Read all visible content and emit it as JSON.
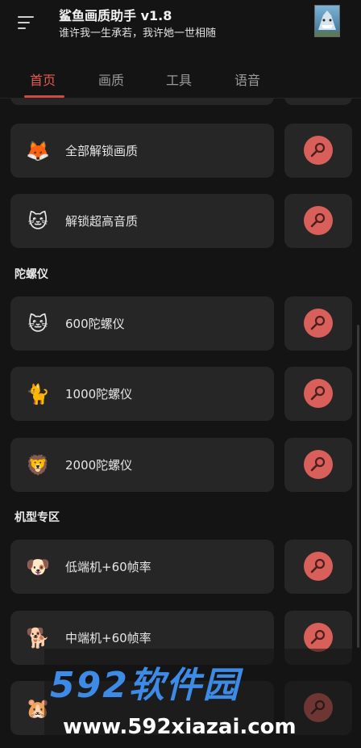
{
  "header": {
    "title": "鲨鱼画质助手 v1.8",
    "subtitle": "谁许我一生承若，我许她一世相随"
  },
  "tabs": [
    {
      "label": "首页",
      "active": true
    },
    {
      "label": "画质",
      "active": false
    },
    {
      "label": "工具",
      "active": false
    },
    {
      "label": "语音",
      "active": false
    }
  ],
  "cards": {
    "unlock_quality": {
      "label": "全部解锁画质",
      "icon": "🦊"
    },
    "unlock_audio": {
      "label": "解锁超高音质",
      "icon": "🐱"
    },
    "gyro_600": {
      "label": "600陀螺仪",
      "icon": "🐱"
    },
    "gyro_1000": {
      "label": "1000陀螺仪",
      "icon": "🐈"
    },
    "gyro_2000": {
      "label": "2000陀螺仪",
      "icon": "🦁"
    },
    "low_end": {
      "label": "低端机+60帧率",
      "icon": "🐶"
    },
    "mid_end": {
      "label": "中端机+60帧率",
      "icon": "🐕"
    },
    "high_end": {
      "label": "",
      "icon": "🐹"
    }
  },
  "sections": {
    "gyro": "陀螺仪",
    "device": "机型专区"
  },
  "watermark": {
    "brand": "592软件园",
    "url": "www.592xiazai.com"
  },
  "colors": {
    "accent": "#e35a50",
    "action_circle": "#d9605a",
    "card_bg": "#262626",
    "page_bg": "#141414"
  }
}
